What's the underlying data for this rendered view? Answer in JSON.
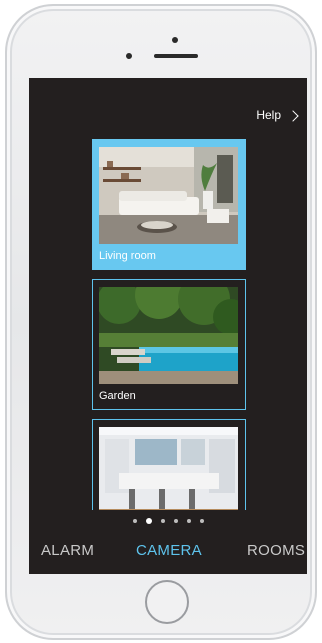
{
  "header": {
    "help_label": "Help"
  },
  "rooms": [
    {
      "label": "Living room",
      "selected": true
    },
    {
      "label": "Garden",
      "selected": false
    },
    {
      "label": "",
      "selected": false
    }
  ],
  "pager": {
    "count": 6,
    "active_index": 1
  },
  "tabs": [
    {
      "label": "ALARM",
      "active": false
    },
    {
      "label": "CAMERA",
      "active": true
    },
    {
      "label": "ROOMS",
      "active": false
    }
  ],
  "colors": {
    "screen_background": "#231f1f",
    "accent": "#5ec3ec",
    "tab_inactive": "#c9c9c9"
  },
  "icons": {
    "help": "chevron-right-icon"
  }
}
